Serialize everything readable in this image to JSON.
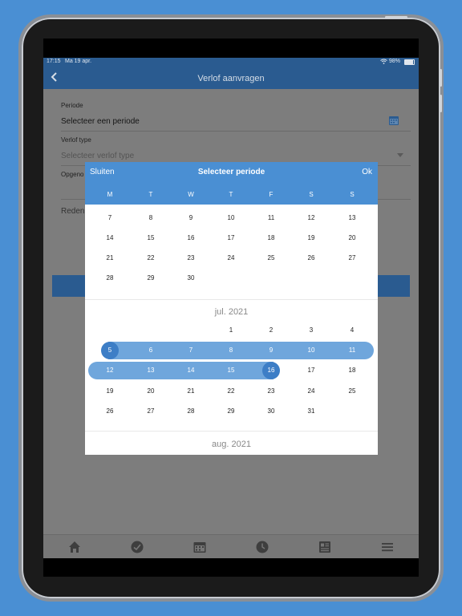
{
  "status": {
    "time": "17:15",
    "date": "Ma 19 apr.",
    "battery": "98%"
  },
  "app": {
    "title": "Verlof aanvragen"
  },
  "form": {
    "periode_label": "Periode",
    "periode_value": "Selecteer een periode",
    "type_label": "Verlof type",
    "type_placeholder": "Selecteer verlof type",
    "opgenomen_label": "Opgeno",
    "reden_label": "Reden"
  },
  "modal": {
    "close_label": "Sluiten",
    "title": "Selecteer periode",
    "ok_label": "Ok",
    "weekdays": [
      "M",
      "T",
      "W",
      "T",
      "F",
      "S",
      "S"
    ],
    "june_rows": [
      [
        "7",
        "8",
        "9",
        "10",
        "11",
        "12",
        "13"
      ],
      [
        "14",
        "15",
        "16",
        "17",
        "18",
        "19",
        "20"
      ],
      [
        "21",
        "22",
        "23",
        "24",
        "25",
        "26",
        "27"
      ],
      [
        "28",
        "29",
        "30",
        "",
        "",
        "",
        ""
      ]
    ],
    "july_label": "jul. 2021",
    "july_rows": [
      [
        "",
        "",
        "",
        "1",
        "2",
        "3",
        "4"
      ],
      [
        "5",
        "6",
        "7",
        "8",
        "9",
        "10",
        "11"
      ],
      [
        "12",
        "13",
        "14",
        "15",
        "16",
        "17",
        "18"
      ],
      [
        "19",
        "20",
        "21",
        "22",
        "23",
        "24",
        "25"
      ],
      [
        "26",
        "27",
        "28",
        "29",
        "30",
        "31",
        ""
      ]
    ],
    "aug_label": "aug. 2021",
    "selected_start": "5",
    "selected_end": "16"
  },
  "icons": [
    "back-icon",
    "calendar-icon",
    "dropdown-icon",
    "home-icon",
    "check-icon",
    "calendar-icon",
    "clock-icon",
    "news-icon",
    "menu-icon"
  ],
  "colors": {
    "accent": "#4a8fd3",
    "range": "#6fa6dc",
    "endpoint": "#3d7ec6",
    "appbar": "#2a5b90"
  }
}
